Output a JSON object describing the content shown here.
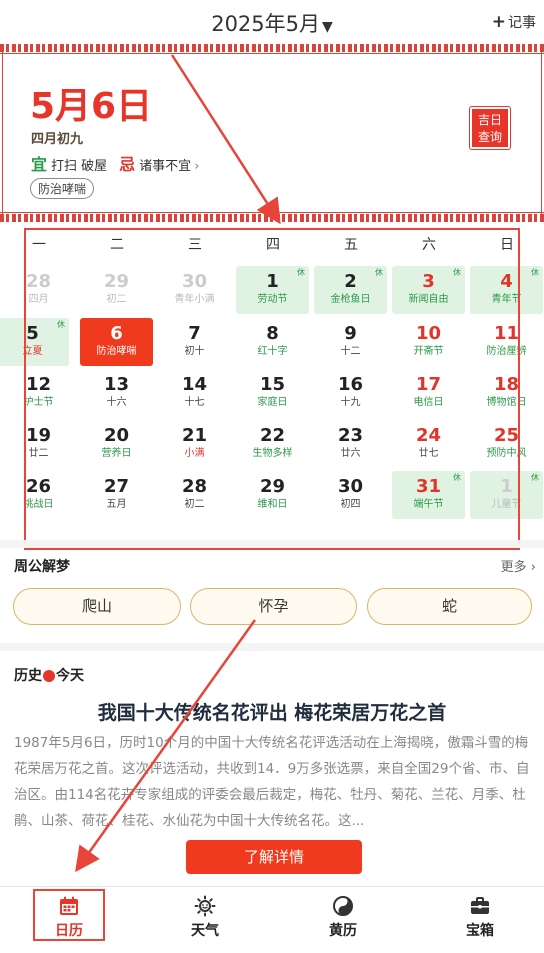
{
  "header": {
    "month_title": "2025年5月",
    "note_label": "记事"
  },
  "card": {
    "big_date": "5月6日",
    "lunar": "四月初九",
    "yi_label": "宜",
    "yi_text": "打扫 破屋",
    "ji_label": "忌",
    "ji_text": "诸事不宜",
    "tag": "防治哮喘",
    "jiri_line1": "吉日",
    "jiri_line2": "查询"
  },
  "calendar": {
    "weekdays": [
      "一",
      "二",
      "三",
      "四",
      "五",
      "六",
      "日"
    ],
    "rows": [
      [
        {
          "num": "28",
          "sub": "四月",
          "type": "prev"
        },
        {
          "num": "29",
          "sub": "初二",
          "type": "prev"
        },
        {
          "num": "30",
          "sub": "青年小满",
          "type": "prev"
        },
        {
          "num": "1",
          "sub": "劳动节",
          "type": "holiday",
          "xiu": "休"
        },
        {
          "num": "2",
          "sub": "金枪鱼日",
          "type": "holiday",
          "xiu": "休"
        },
        {
          "num": "3",
          "sub": "新闻自由",
          "type": "holiday-red",
          "xiu": "休"
        },
        {
          "num": "4",
          "sub": "青年节",
          "type": "holiday-red",
          "xiu": "休"
        }
      ],
      [
        {
          "num": "5",
          "sub": "立夏",
          "type": "holiday-sub-red",
          "xiu": "休"
        },
        {
          "num": "6",
          "sub": "防治哮喘",
          "type": "selected"
        },
        {
          "num": "7",
          "sub": "初十",
          "type": "normal"
        },
        {
          "num": "8",
          "sub": "红十字",
          "type": "normal-green"
        },
        {
          "num": "9",
          "sub": "十二",
          "type": "normal"
        },
        {
          "num": "10",
          "sub": "开斋节",
          "type": "weekend-green"
        },
        {
          "num": "11",
          "sub": "防治厘辨",
          "type": "weekend-green"
        }
      ],
      [
        {
          "num": "12",
          "sub": "护士节",
          "type": "normal-green"
        },
        {
          "num": "13",
          "sub": "十六",
          "type": "normal"
        },
        {
          "num": "14",
          "sub": "十七",
          "type": "normal"
        },
        {
          "num": "15",
          "sub": "家庭日",
          "type": "normal-green"
        },
        {
          "num": "16",
          "sub": "十九",
          "type": "normal"
        },
        {
          "num": "17",
          "sub": "电信日",
          "type": "weekend-green"
        },
        {
          "num": "18",
          "sub": "博物馆日",
          "type": "weekend-green"
        }
      ],
      [
        {
          "num": "19",
          "sub": "廿二",
          "type": "normal"
        },
        {
          "num": "20",
          "sub": "营养日",
          "type": "normal-green"
        },
        {
          "num": "21",
          "sub": "小满",
          "type": "normal-red"
        },
        {
          "num": "22",
          "sub": "生物多样",
          "type": "normal-green"
        },
        {
          "num": "23",
          "sub": "廿六",
          "type": "normal"
        },
        {
          "num": "24",
          "sub": "廿七",
          "type": "weekend"
        },
        {
          "num": "25",
          "sub": "预防中风",
          "type": "weekend-green"
        }
      ],
      [
        {
          "num": "26",
          "sub": "挑战日",
          "type": "normal-green"
        },
        {
          "num": "27",
          "sub": "五月",
          "type": "normal"
        },
        {
          "num": "28",
          "sub": "初二",
          "type": "normal"
        },
        {
          "num": "29",
          "sub": "维和日",
          "type": "normal-green"
        },
        {
          "num": "30",
          "sub": "初四",
          "type": "normal"
        },
        {
          "num": "31",
          "sub": "端午节",
          "type": "holiday-red",
          "xiu": "休"
        },
        {
          "num": "1",
          "sub": "儿童节",
          "type": "holiday-next",
          "xiu": "休"
        }
      ]
    ]
  },
  "dream": {
    "title": "周公解梦",
    "more": "更多",
    "items": [
      "爬山",
      "怀孕",
      "蛇"
    ]
  },
  "history": {
    "head_left": "历史",
    "head_right": "今天",
    "title": "我国十大传统名花评出 梅花荣居万花之首",
    "body": "1987年5月6日，历时10个月的中国十大传统名花评选活动在上海揭晓，傲霜斗雪的梅花荣居万花之首。这次评选活动，共收到14．9万多张选票，来自全国29个省、市、自治区。由114名花卉专家组成的评委会最后裁定，梅花、牡丹、菊花、兰花、月季、杜鹃、山茶、荷花、桂花、水仙花为中国十大传统名花。这...",
    "button": "了解详情"
  },
  "nav": [
    {
      "label": "日历",
      "icon": "calendar-icon",
      "active": true
    },
    {
      "label": "天气",
      "icon": "weather-icon",
      "active": false
    },
    {
      "label": "黄历",
      "icon": "yinyang-icon",
      "active": false
    },
    {
      "label": "宝箱",
      "icon": "toolbox-icon",
      "active": false
    }
  ],
  "colors": {
    "accent": "#e8352a",
    "holiday_bg": "#e0f3e2",
    "green": "#2c9a4a"
  }
}
